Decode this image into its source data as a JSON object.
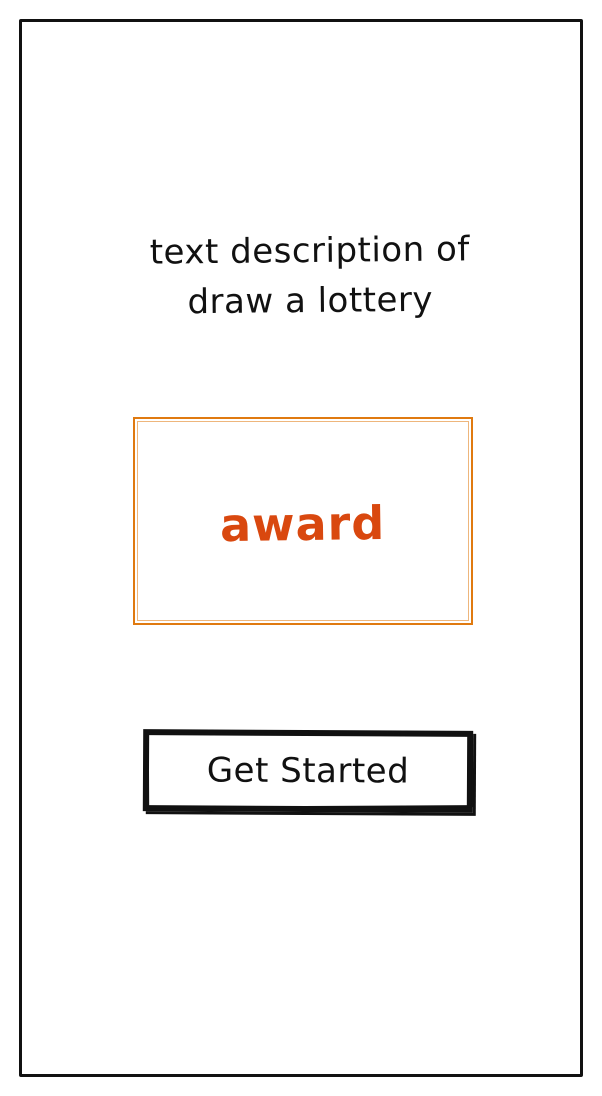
{
  "screen": {
    "description_lines": [
      "text description of",
      "draw a lottery"
    ]
  },
  "award": {
    "label": "award",
    "color": "#d9480f",
    "border_color": "#e07a10"
  },
  "cta": {
    "label": "Get Started"
  }
}
